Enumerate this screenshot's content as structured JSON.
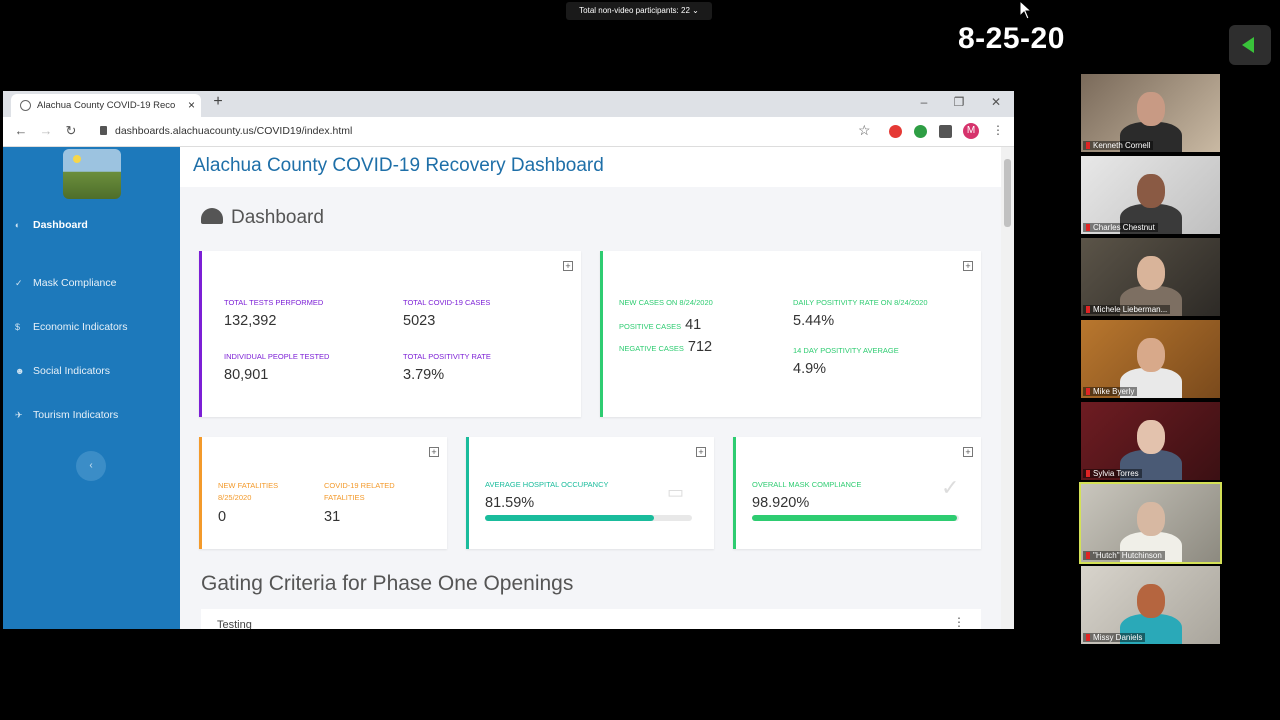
{
  "meeting": {
    "participants_pill": "Total non-video participants: 22",
    "date_stamp": "8-25-20"
  },
  "browser": {
    "tab_title": "Alachua County COVID-19 Reco",
    "url": "dashboards.alachuacounty.us/COVID19/index.html",
    "profile_initial": "M"
  },
  "sidebar": {
    "items": [
      {
        "label": "Dashboard",
        "icon": "gauge-icon",
        "active": true
      },
      {
        "label": "Mask Compliance",
        "icon": "check-icon",
        "active": false
      },
      {
        "label": "Economic Indicators",
        "icon": "dollar-icon",
        "active": false
      },
      {
        "label": "Social Indicators",
        "icon": "users-icon",
        "active": false
      },
      {
        "label": "Tourism Indicators",
        "icon": "plane-icon",
        "active": false
      }
    ]
  },
  "header": {
    "site_title": "Alachua County COVID-19 Recovery Dashboard"
  },
  "dashboard": {
    "heading": "Dashboard",
    "tests_card": {
      "total_tests_label": "TOTAL TESTS PERFORMED",
      "total_tests_value": "132,392",
      "total_cases_label": "TOTAL COVID-19 CASES",
      "total_cases_value": "5023",
      "people_tested_label": "INDIVIDUAL PEOPLE TESTED",
      "people_tested_value": "80,901",
      "positivity_label": "TOTAL POSITIVITY RATE",
      "positivity_value": "3.79%",
      "accent": "#7c1fd6"
    },
    "daily_card": {
      "new_cases_label": "NEW CASES ON 8/24/2020",
      "positive_label": "POSITIVE CASES",
      "positive_value": "41",
      "negative_label": "NEGATIVE CASES",
      "negative_value": "712",
      "daily_rate_label": "DAILY POSITIVITY RATE ON 8/24/2020",
      "daily_rate_value": "5.44%",
      "avg14_label": "14 DAY POSITIVITY AVERAGE",
      "avg14_value": "4.9%",
      "accent": "#2ecc71"
    },
    "fatalities_card": {
      "new_fatalities_label": "NEW FATALITIES 8/25/2020",
      "new_fatalities_value": "0",
      "related_label": "COVID-19 RELATED FATALITIES",
      "related_value": "31",
      "accent": "#f39a2b"
    },
    "hospital_card": {
      "label": "AVERAGE HOSPITAL OCCUPANCY",
      "value": "81.59%",
      "fill_fraction": 0.8159,
      "icon": "bed-icon",
      "accent": "#1abc9c"
    },
    "mask_card": {
      "label": "OVERALL MASK COMPLIANCE",
      "value": "98.920%",
      "fill_fraction": 0.9892,
      "icon": "check-icon",
      "accent": "#2ecc71"
    },
    "gating_heading": "Gating Criteria for Phase One Openings",
    "testing_label": "Testing"
  },
  "participants": [
    {
      "name": "Kenneth Cornell",
      "active": false
    },
    {
      "name": "Charles Chestnut",
      "active": false
    },
    {
      "name": "Michele Lieberman...",
      "active": false
    },
    {
      "name": "Mike Byerly",
      "active": false
    },
    {
      "name": "Sylvia Torres",
      "active": false
    },
    {
      "name": "\"Hutch\" Hutchinson",
      "active": true
    },
    {
      "name": "Missy Daniels",
      "active": false
    }
  ]
}
